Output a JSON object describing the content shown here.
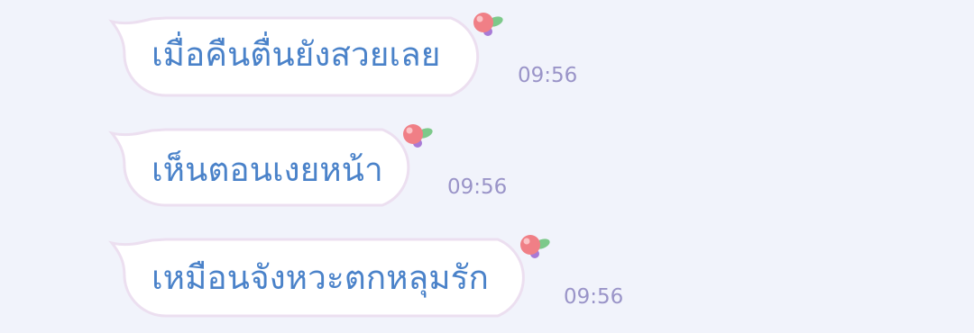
{
  "messages": [
    {
      "text": "เมื่อคืนตื่นยังสวยเลย",
      "time": "09:56"
    },
    {
      "text": "เห็นตอนเงยหน้า",
      "time": "09:56"
    },
    {
      "text": "เหมือนจังหวะตกหลุมรัก",
      "time": "09:56"
    }
  ],
  "colors": {
    "background": "#f1f3fb",
    "bubble_fill": "#ffffff",
    "bubble_border": "#ecdff0",
    "text": "#4a82c9",
    "timestamp": "#9a94c8",
    "flower": "#f07f86",
    "leaf": "#7dc98a",
    "berry": "#a87ad6"
  },
  "decorations": {
    "bubble_sticker": "flower-sticker-icon"
  }
}
